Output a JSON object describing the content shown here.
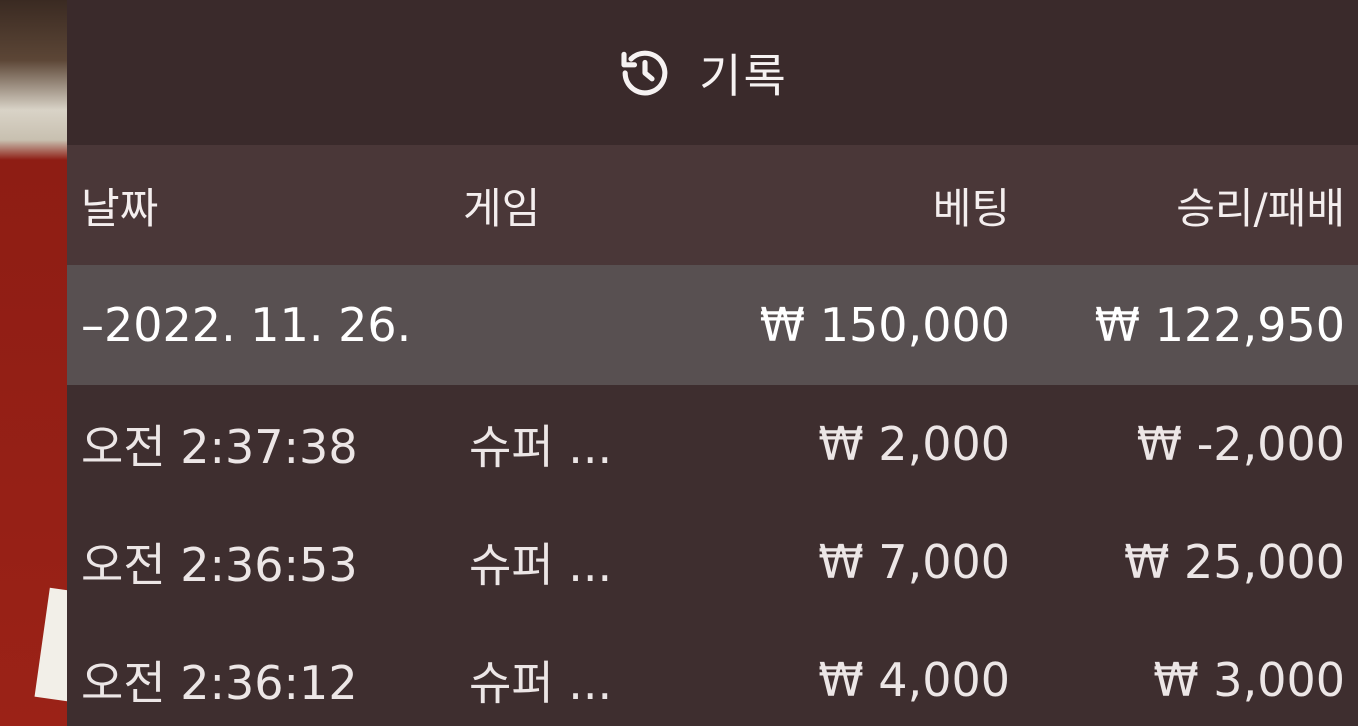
{
  "header": {
    "icon": "history-icon",
    "title": "기록"
  },
  "columns": {
    "date": "날짜",
    "game": "게임",
    "bet": "베팅",
    "result": "승리/패배"
  },
  "summary": {
    "date": "–2022. 11. 26.",
    "bet": "₩ 150,000",
    "result": "₩ 122,950"
  },
  "rows": [
    {
      "time": "오전 2:37:38",
      "game": "슈퍼 ...",
      "bet": "₩ 2,000",
      "result": "₩ -2,000"
    },
    {
      "time": "오전 2:36:53",
      "game": "슈퍼 ...",
      "bet": "₩ 7,000",
      "result": "₩ 25,000"
    },
    {
      "time": "오전 2:36:12",
      "game": "슈퍼 ...",
      "bet": "₩ 4,000",
      "result": "₩ 3,000"
    }
  ],
  "colors": {
    "panel": "#3e2e2f",
    "header_row": "#4a3738",
    "summary_row": "#585051",
    "text": "#f4eeee"
  }
}
